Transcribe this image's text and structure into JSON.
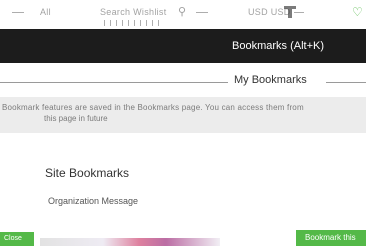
{
  "toolbar": {
    "all_label": "All",
    "search_text": "Search Wishlist",
    "currency_label": "USD USD",
    "icons": [
      "search-icon",
      "cart-icon",
      "heart-icon"
    ],
    "heart_color": "#53b848"
  },
  "bookmarks_header": {
    "title": "Bookmarks (Alt+K)"
  },
  "my_bookmarks": {
    "label": "My Bookmarks"
  },
  "info": {
    "line1": "Bookmark features are saved in the Bookmarks page. You can access them from",
    "line2": "this page in future"
  },
  "site_bookmarks": {
    "title": "Site Bookmarks",
    "message": "Organization Message"
  },
  "actions": {
    "left_button": "Close",
    "right_button": "Bookmark this"
  },
  "colors": {
    "header_bg": "#1c1c1c",
    "accent_green": "#54b948",
    "info_bg": "#ececec"
  }
}
